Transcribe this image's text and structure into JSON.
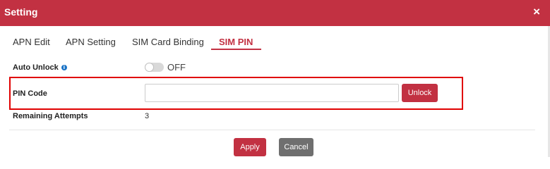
{
  "header": {
    "title": "Setting",
    "close_symbol": "×"
  },
  "tabs": [
    {
      "label": "APN Edit",
      "active": false
    },
    {
      "label": "APN Setting",
      "active": false
    },
    {
      "label": "SIM Card Binding",
      "active": false
    },
    {
      "label": "SIM PIN",
      "active": true
    }
  ],
  "form": {
    "auto_unlock": {
      "label": "Auto Unlock",
      "info_icon": "i",
      "state": "OFF"
    },
    "pin_code": {
      "label": "PIN Code",
      "value": "",
      "button_label": "Unlock"
    },
    "remaining_attempts": {
      "label": "Remaining Attempts",
      "value": "3"
    }
  },
  "footer": {
    "apply_label": "Apply",
    "cancel_label": "Cancel"
  },
  "colors": {
    "accent": "#c23142",
    "highlight_border": "#e00000",
    "cancel": "#6f6f6f",
    "info": "#1a73c6"
  }
}
